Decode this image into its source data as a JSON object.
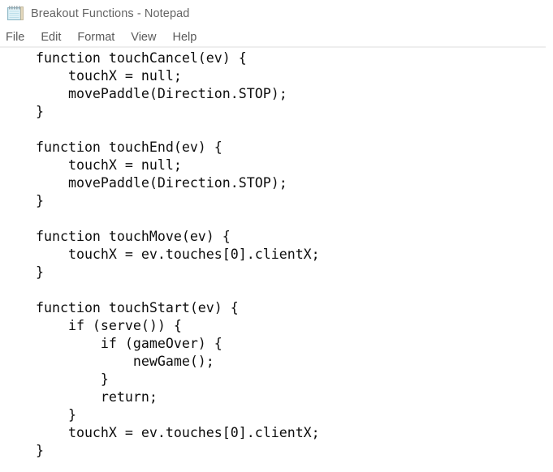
{
  "window": {
    "title": "Breakout Functions - Notepad",
    "icon": "notepad-icon",
    "background_color": "#ffffff",
    "title_color": "#646464"
  },
  "menubar": {
    "items": [
      {
        "label": "File"
      },
      {
        "label": "Edit"
      },
      {
        "label": "Format"
      },
      {
        "label": "View"
      },
      {
        "label": "Help"
      }
    ]
  },
  "editor": {
    "text_color": "#0d0d0d",
    "content": "function touchCancel(ev) {\n    touchX = null;\n    movePaddle(Direction.STOP);\n}\n\nfunction touchEnd(ev) {\n    touchX = null;\n    movePaddle(Direction.STOP);\n}\n\nfunction touchMove(ev) {\n    touchX = ev.touches[0].clientX;\n}\n\nfunction touchStart(ev) {\n    if (serve()) {\n        if (gameOver) {\n            newGame();\n        }\n        return;\n    }\n    touchX = ev.touches[0].clientX;\n}",
    "lines": [
      "function touchCancel(ev) {",
      "    touchX = null;",
      "    movePaddle(Direction.STOP);",
      "}",
      "",
      "function touchEnd(ev) {",
      "    touchX = null;",
      "    movePaddle(Direction.STOP);",
      "}",
      "",
      "function touchMove(ev) {",
      "    touchX = ev.touches[0].clientX;",
      "}",
      "",
      "function touchStart(ev) {",
      "    if (serve()) {",
      "        if (gameOver) {",
      "            newGame();",
      "        }",
      "        return;",
      "    }",
      "    touchX = ev.touches[0].clientX;",
      "}"
    ]
  }
}
